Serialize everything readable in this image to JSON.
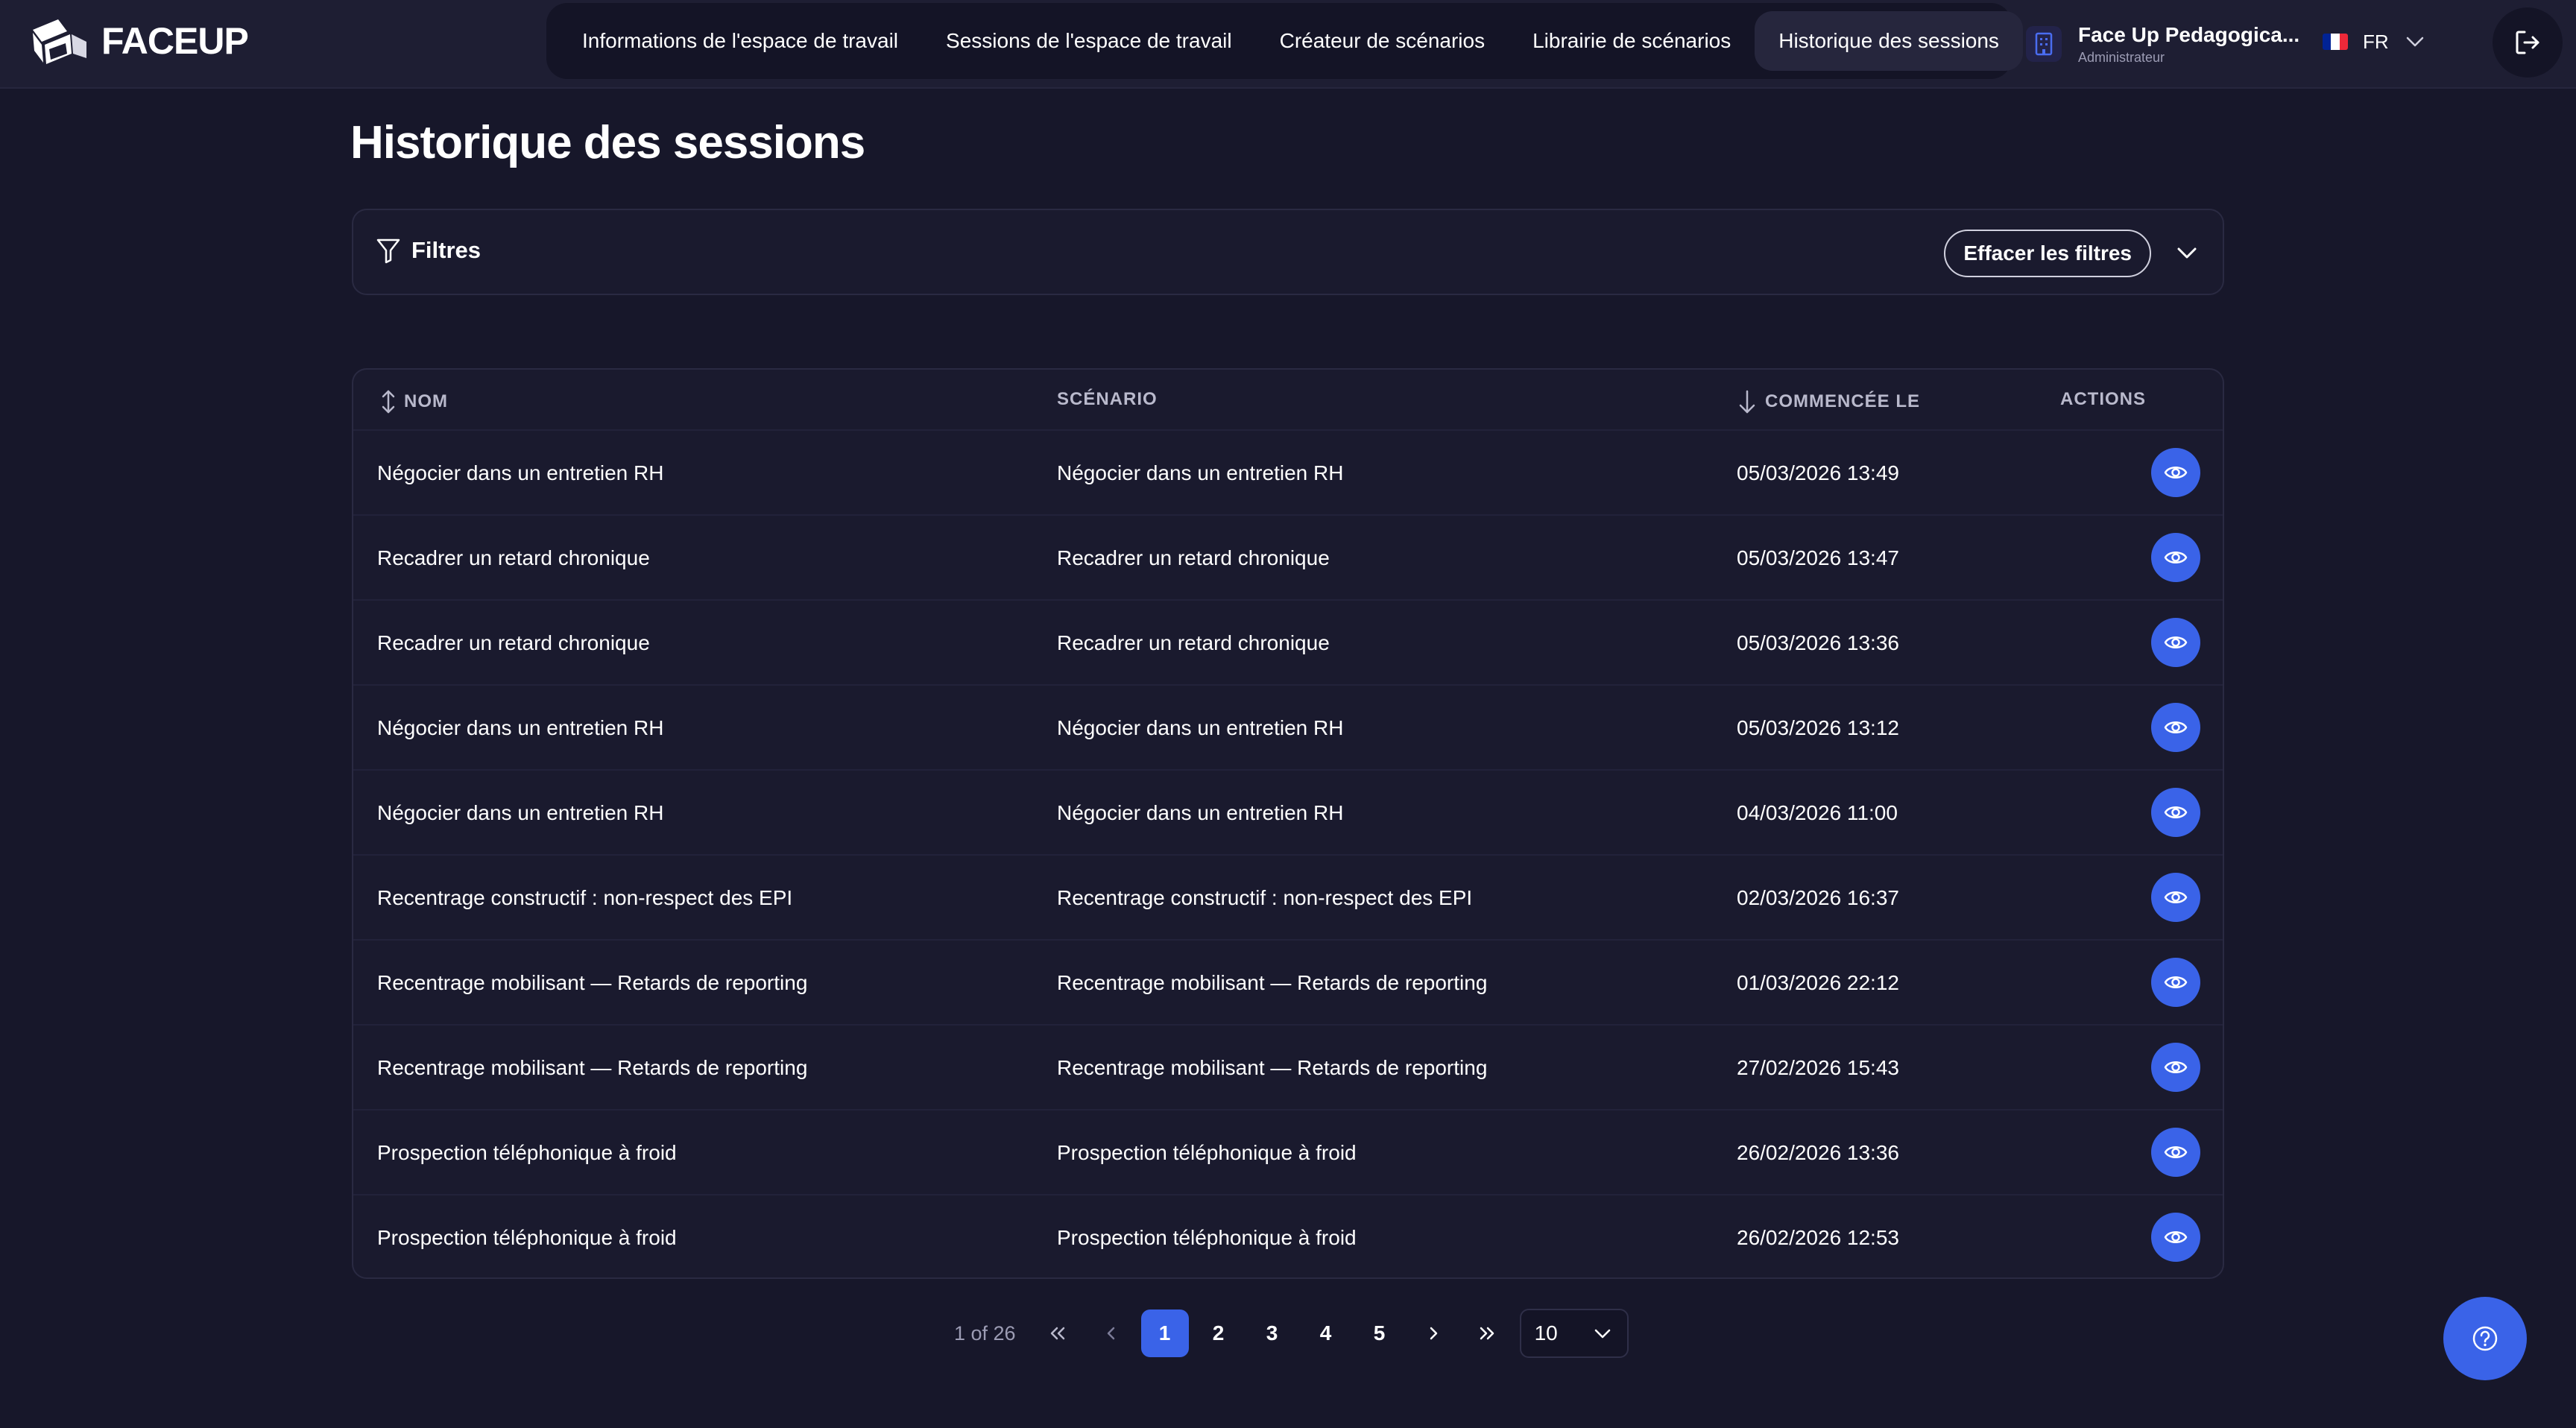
{
  "brand": {
    "name": "FACEUP"
  },
  "nav": {
    "items": [
      {
        "label": "Informations de l'espace de travail",
        "active": false
      },
      {
        "label": "Sessions de l'espace de travail",
        "active": false
      },
      {
        "label": "Créateur de scénarios",
        "active": false
      },
      {
        "label": "Librairie de scénarios",
        "active": false
      },
      {
        "label": "Historique des sessions",
        "active": true
      }
    ]
  },
  "workspace": {
    "name": "Face Up Pedagogica...",
    "role": "Administrateur",
    "icon": "building-icon"
  },
  "language": {
    "code": "FR",
    "flag_colors": [
      "#002395",
      "#ffffff",
      "#ed2939"
    ]
  },
  "page": {
    "title": "Historique des sessions"
  },
  "filters": {
    "label": "Filtres",
    "clear_label": "Effacer les filtres"
  },
  "table": {
    "columns": {
      "name": "NOM",
      "scenario": "SCÉNARIO",
      "started": "COMMENCÉE LE",
      "actions": "ACTIONS"
    },
    "rows": [
      {
        "name": "Négocier dans un entretien RH",
        "scenario": "Négocier dans un entretien RH",
        "started": "05/03/2026 13:49"
      },
      {
        "name": "Recadrer un retard chronique",
        "scenario": "Recadrer un retard chronique",
        "started": "05/03/2026 13:47"
      },
      {
        "name": "Recadrer un retard chronique",
        "scenario": "Recadrer un retard chronique",
        "started": "05/03/2026 13:36"
      },
      {
        "name": "Négocier dans un entretien RH",
        "scenario": "Négocier dans un entretien RH",
        "started": "05/03/2026 13:12"
      },
      {
        "name": "Négocier dans un entretien RH",
        "scenario": "Négocier dans un entretien RH",
        "started": "04/03/2026 11:00"
      },
      {
        "name": "Recentrage constructif : non-respect des EPI",
        "scenario": "Recentrage constructif : non-respect des EPI",
        "started": "02/03/2026 16:37"
      },
      {
        "name": "Recentrage mobilisant — Retards de reporting",
        "scenario": "Recentrage mobilisant — Retards de reporting",
        "started": "01/03/2026 22:12"
      },
      {
        "name": "Recentrage mobilisant — Retards de reporting",
        "scenario": "Recentrage mobilisant — Retards de reporting",
        "started": "27/02/2026 15:43"
      },
      {
        "name": "Prospection téléphonique à froid",
        "scenario": "Prospection téléphonique à froid",
        "started": "26/02/2026 13:36"
      },
      {
        "name": "Prospection téléphonique à froid",
        "scenario": "Prospection téléphonique à froid",
        "started": "26/02/2026 12:53"
      }
    ]
  },
  "pagination": {
    "info": "1 of 26",
    "pages": [
      "1",
      "2",
      "3",
      "4",
      "5"
    ],
    "current": "1",
    "page_size": "10"
  },
  "colors": {
    "accent": "#3a63e8",
    "background": "#17172a"
  }
}
